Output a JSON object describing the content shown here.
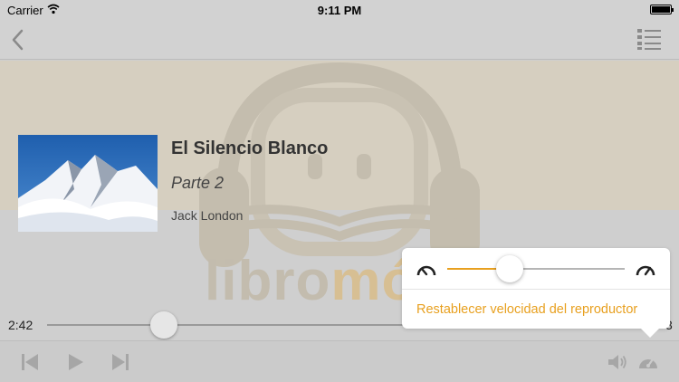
{
  "status_bar": {
    "carrier": "Carrier",
    "time": "9:11 PM"
  },
  "nav": {
    "back_icon": "chevron-left-icon",
    "list_icon": "list-icon"
  },
  "watermark": {
    "text_prefix": "libro",
    "text_suffix": "mó"
  },
  "book": {
    "title": "El Silencio Blanco",
    "part": "Parte 2",
    "author": "Jack London"
  },
  "player": {
    "elapsed": "2:42",
    "total": "3",
    "progress_fraction": 0.19
  },
  "speed_popover": {
    "reset_label": "Restablecer velocidad del reproductor",
    "speed_fraction": 0.35
  },
  "colors": {
    "accent": "#e8a01f",
    "hero_bg": "#d6cfc0",
    "bg": "#cfcfcf"
  },
  "toolbar": {
    "icons": [
      "skip-back-icon",
      "play-icon",
      "skip-forward-icon",
      "volume-icon",
      "speedometer-icon"
    ]
  }
}
